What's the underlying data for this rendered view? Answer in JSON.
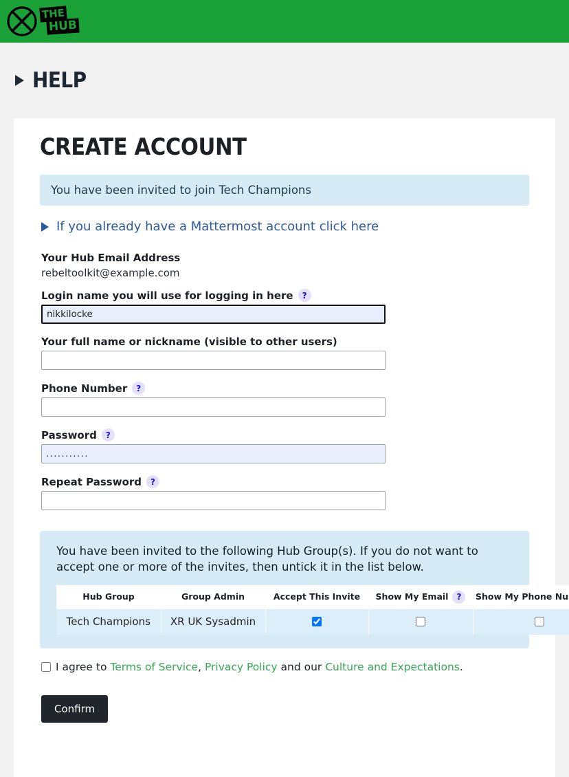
{
  "header": {
    "logo_alt": "Extinction Rebellion hourglass logo",
    "brand_line1": "THE",
    "brand_line2": "HUB",
    "background_color": "#1aa238"
  },
  "help_bar": {
    "label": "HELP"
  },
  "main": {
    "title": "CREATE ACCOUNT",
    "invite_alert": "You have been invited to join Tech Champions",
    "mattermost_link": "If you already have a Mattermost account click here",
    "fields": {
      "hub_email": {
        "label": "Your Hub Email Address",
        "value": "rebeltoolkit@example.com"
      },
      "login_name": {
        "label": "Login name you will use for logging in here",
        "help": "?",
        "value": "nikkilocke",
        "placeholder": ""
      },
      "full_name": {
        "label": "Your full name or nickname (visible to other users)",
        "value": "",
        "placeholder": ""
      },
      "phone": {
        "label": "Phone Number",
        "help": "?",
        "value": "",
        "placeholder": ""
      },
      "password": {
        "label": "Password",
        "help": "?",
        "value": "...........",
        "placeholder": ""
      },
      "repeat_password": {
        "label": "Repeat Password",
        "help": "?",
        "value": "",
        "placeholder": ""
      }
    },
    "groups_panel": {
      "intro": "You have been invited to the following Hub Group(s). If you do not want to accept one or more of the invites, then untick it in the list below.",
      "columns": [
        {
          "label": "Hub Group",
          "help": ""
        },
        {
          "label": "Group Admin",
          "help": ""
        },
        {
          "label": "Accept This Invite",
          "help": ""
        },
        {
          "label": "Show My Email",
          "help": "?"
        },
        {
          "label": "Show My Phone Number",
          "help": "?"
        }
      ],
      "rows": [
        {
          "hub_group": "Tech Champions",
          "group_admin": "XR UK Sysadmin",
          "accept_invite": true,
          "show_email": false,
          "show_phone": false
        }
      ]
    },
    "agreement": {
      "checked": false,
      "prefix": "I agree to ",
      "link_terms": "Terms of Service",
      "sep1": ", ",
      "link_privacy": "Privacy Policy",
      "mid": " and our ",
      "link_culture": "Culture and Expectations",
      "suffix": "."
    },
    "confirm_button": "Confirm"
  },
  "colors": {
    "brand_green": "#1aa238",
    "link_blue": "#2c5aa0",
    "link_green": "#35a853",
    "alert_blue_bg": "#d6ebf6",
    "autofill_bg": "#e8eefc",
    "button_dark": "#21262c"
  }
}
